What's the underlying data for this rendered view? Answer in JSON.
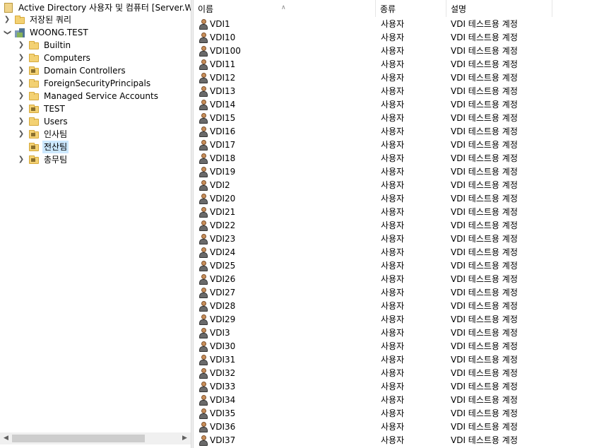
{
  "tree": {
    "root_label": "Active Directory 사용자 및 컴퓨터 [Server.WOONG.TEST]",
    "saved_queries_label": "저장된 쿼리",
    "domain_label": "WOONG.TEST",
    "children": [
      {
        "label": "Builtin",
        "type": "folder"
      },
      {
        "label": "Computers",
        "type": "folder"
      },
      {
        "label": "Domain Controllers",
        "type": "ou"
      },
      {
        "label": "ForeignSecurityPrincipals",
        "type": "folder"
      },
      {
        "label": "Managed Service Accounts",
        "type": "folder"
      },
      {
        "label": "TEST",
        "type": "ou"
      },
      {
        "label": "Users",
        "type": "folder"
      },
      {
        "label": "인사팀",
        "type": "ou"
      },
      {
        "label": "전산팀",
        "type": "ou",
        "selected": true,
        "no_chevron": true
      },
      {
        "label": "총무팀",
        "type": "ou"
      }
    ]
  },
  "list": {
    "columns": {
      "name": "이름",
      "type": "종류",
      "description": "설명"
    },
    "rows": [
      {
        "name": "VDI1",
        "type": "사용자",
        "description": "VDI 테스트용 계정"
      },
      {
        "name": "VDI10",
        "type": "사용자",
        "description": "VDI 테스트용 계정"
      },
      {
        "name": "VDI100",
        "type": "사용자",
        "description": "VDI 테스트용 계정"
      },
      {
        "name": "VDI11",
        "type": "사용자",
        "description": "VDI 테스트용 계정"
      },
      {
        "name": "VDI12",
        "type": "사용자",
        "description": "VDI 테스트용 계정"
      },
      {
        "name": "VDI13",
        "type": "사용자",
        "description": "VDI 테스트용 계정"
      },
      {
        "name": "VDI14",
        "type": "사용자",
        "description": "VDI 테스트용 계정"
      },
      {
        "name": "VDI15",
        "type": "사용자",
        "description": "VDI 테스트용 계정"
      },
      {
        "name": "VDI16",
        "type": "사용자",
        "description": "VDI 테스트용 계정"
      },
      {
        "name": "VDI17",
        "type": "사용자",
        "description": "VDI 테스트용 계정"
      },
      {
        "name": "VDI18",
        "type": "사용자",
        "description": "VDI 테스트용 계정"
      },
      {
        "name": "VDI19",
        "type": "사용자",
        "description": "VDI 테스트용 계정"
      },
      {
        "name": "VDI2",
        "type": "사용자",
        "description": "VDI 테스트용 계정"
      },
      {
        "name": "VDI20",
        "type": "사용자",
        "description": "VDI 테스트용 계정"
      },
      {
        "name": "VDI21",
        "type": "사용자",
        "description": "VDI 테스트용 계정"
      },
      {
        "name": "VDI22",
        "type": "사용자",
        "description": "VDI 테스트용 계정"
      },
      {
        "name": "VDI23",
        "type": "사용자",
        "description": "VDI 테스트용 계정"
      },
      {
        "name": "VDI24",
        "type": "사용자",
        "description": "VDI 테스트용 계정"
      },
      {
        "name": "VDI25",
        "type": "사용자",
        "description": "VDI 테스트용 계정"
      },
      {
        "name": "VDI26",
        "type": "사용자",
        "description": "VDI 테스트용 계정"
      },
      {
        "name": "VDI27",
        "type": "사용자",
        "description": "VDI 테스트용 계정"
      },
      {
        "name": "VDI28",
        "type": "사용자",
        "description": "VDI 테스트용 계정"
      },
      {
        "name": "VDI29",
        "type": "사용자",
        "description": "VDI 테스트용 계정"
      },
      {
        "name": "VDI3",
        "type": "사용자",
        "description": "VDI 테스트용 계정"
      },
      {
        "name": "VDI30",
        "type": "사용자",
        "description": "VDI 테스트용 계정"
      },
      {
        "name": "VDI31",
        "type": "사용자",
        "description": "VDI 테스트용 계정"
      },
      {
        "name": "VDI32",
        "type": "사용자",
        "description": "VDI 테스트용 계정"
      },
      {
        "name": "VDI33",
        "type": "사용자",
        "description": "VDI 테스트용 계정"
      },
      {
        "name": "VDI34",
        "type": "사용자",
        "description": "VDI 테스트용 계정"
      },
      {
        "name": "VDI35",
        "type": "사용자",
        "description": "VDI 테스트용 계정"
      },
      {
        "name": "VDI36",
        "type": "사용자",
        "description": "VDI 테스트용 계정"
      },
      {
        "name": "VDI37",
        "type": "사용자",
        "description": "VDI 테스트용 계정"
      }
    ]
  },
  "colors": {
    "selection": "#cce8ff",
    "folder": "#f3d173"
  }
}
